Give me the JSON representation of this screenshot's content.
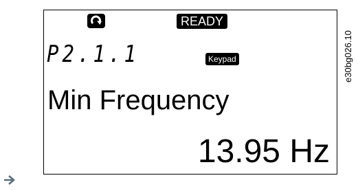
{
  "display": {
    "status": "READY",
    "control_place": "Keypad",
    "parameter_code": "P2.1.1",
    "parameter_name": "Min Frequency",
    "parameter_value": "13.95 Hz"
  },
  "figure_id": "e30bg026.10",
  "icons": {
    "run_status": "rotation-arrow-icon",
    "navigation": "arrow-right-icon"
  },
  "colors": {
    "lcd_ink": "#000000",
    "lcd_background": "#ffffff",
    "arrow": "#5a6e78"
  }
}
